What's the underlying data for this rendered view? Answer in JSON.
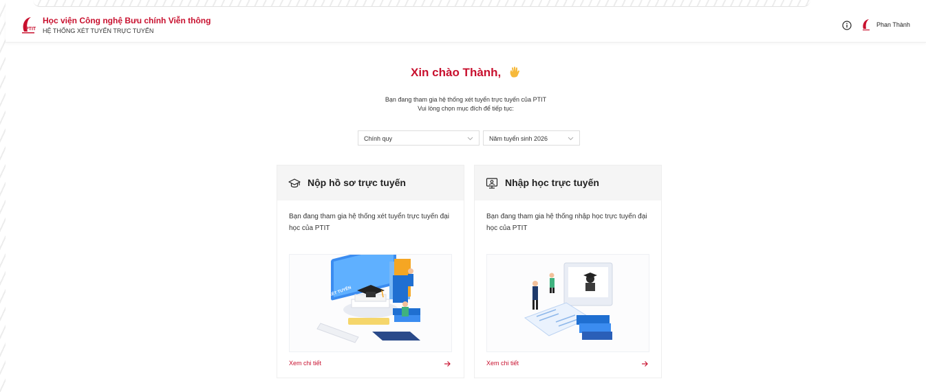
{
  "header": {
    "title": "Học viện Công nghệ Bưu chính Viễn thông",
    "subtitle": "HỆ THỐNG XÉT TUYỂN TRỰC TUYẾN",
    "logo_text": "PTIT",
    "user_name": "Phan Thành"
  },
  "welcome": {
    "greeting": "Xin chào Thành,",
    "line1": "Bạn đang tham gia hệ thống xét tuyển trực tuyến của PTIT",
    "line2": "Vui lòng chọn mục đích để tiếp tục:"
  },
  "filters": {
    "program": "Chính quy",
    "year": "Năm tuyển sinh 2026"
  },
  "cards": [
    {
      "title": "Nộp hồ sơ trực tuyến",
      "icon": "graduation-cap-icon",
      "description": "Bạn đang tham gia hệ thống xét tuyển trực tuyến đại học của PTIT",
      "illustration_text": "XÉT TUYỂN",
      "link": "Xem chi tiết"
    },
    {
      "title": "Nhập học trực tuyến",
      "icon": "monitor-student-icon",
      "description": "Bạn đang tham gia hệ thống nhập học trực tuyến đại học của PTIT",
      "link": "Xem chi tiết"
    }
  ],
  "colors": {
    "brand": "#c8102e",
    "card_header_bg": "#f5f5f5",
    "illustration_blue": "#2f80ed",
    "illustration_orange": "#f5a623"
  }
}
